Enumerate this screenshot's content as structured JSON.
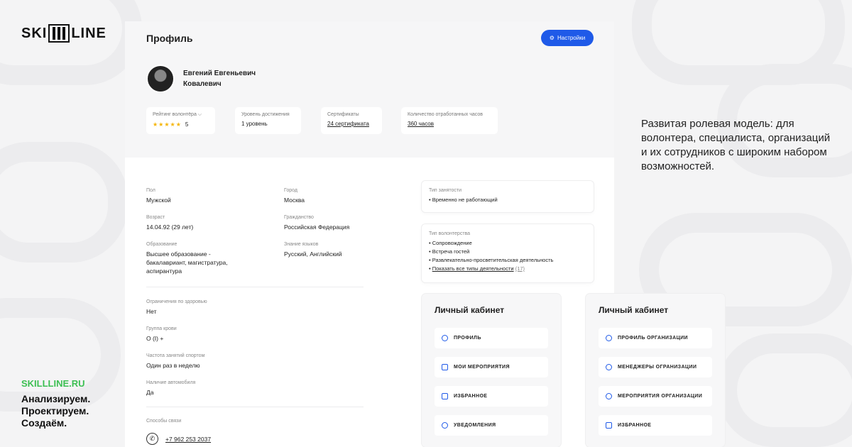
{
  "brand": {
    "logo_left": "SKI",
    "logo_right": "LINE",
    "site": "SKILLLINE.RU",
    "slogan": [
      "Анализируем.",
      "Проектируем.",
      "Создаём."
    ]
  },
  "headline": "Развитая ролевая модель: для волонтера, специалиста, организаций и их сотрудников с широким набором возможностей.",
  "profile": {
    "title": "Профиль",
    "settings_label": "Настройки",
    "name_line1": "Евгений Евгеньевич",
    "name_line2": "Ковалевич",
    "stats": [
      {
        "label": "Рейтинг волонтёра ⌵",
        "value": "5",
        "stars": "★★★★★"
      },
      {
        "label": "Уровень достижения",
        "value": "1 уровень"
      },
      {
        "label": "Сертификаты",
        "value": "24 сертификата"
      },
      {
        "label": "Количество отработанных часов",
        "value": "360 часов"
      }
    ]
  },
  "details": {
    "gender": {
      "label": "Пол",
      "value": "Мужской"
    },
    "city": {
      "label": "Город",
      "value": "Москва"
    },
    "age": {
      "label": "Возраст",
      "value": "14.04.92 (29 лет)"
    },
    "citizenship": {
      "label": "Гражданство",
      "value": "Российская Федерация"
    },
    "education": {
      "label": "Образование",
      "value": "Высшее образование - бакалавриант, магистратура, аспирантура"
    },
    "languages": {
      "label": "Знание языков",
      "value": "Русский, Английский"
    },
    "health": {
      "label": "Ограничения по здоровью",
      "value": "Нет"
    },
    "blood": {
      "label": "Группа крови",
      "value": "O (I) +"
    },
    "sport": {
      "label": "Частота занятий спортом",
      "value": "Один раз в неделю"
    },
    "car": {
      "label": "Наличие автомобиля",
      "value": "Да"
    },
    "contacts": {
      "label": "Способы связи",
      "phone": "+7 962 253 2037"
    }
  },
  "employment": {
    "label": "Тип занятости",
    "items": [
      "• Временно не работающий"
    ]
  },
  "volunteering": {
    "label": "Тип волонтерства",
    "items": [
      "• Сопровождение",
      "• Встреча гостей",
      "• Развлекательно-просветительская деятельность"
    ],
    "more": "Показать все типы деятельности",
    "more_hint": "(17)"
  },
  "cabinet_volunteer": {
    "title": "Личный кабинет",
    "items": [
      "ПРОФИЛЬ",
      "МОИ МЕРОПРИЯТИЯ",
      "ИЗБРАННОЕ",
      "УВЕДОМЛЕНИЯ"
    ]
  },
  "cabinet_org": {
    "title": "Личный кабинет",
    "items": [
      "ПРОФИЛЬ ОРГАНИЗАЦИИ",
      "МЕНЕДЖЕРЫ ОГРАНИЗАЦИИ",
      "МЕРОПРИЯТИЯ ОРГАНИЗАЦИИ",
      "ИЗБРАННОЕ"
    ]
  },
  "colors": {
    "accent": "#1f5ae8",
    "brand_green": "#3cbf52",
    "star": "#f5b400"
  }
}
